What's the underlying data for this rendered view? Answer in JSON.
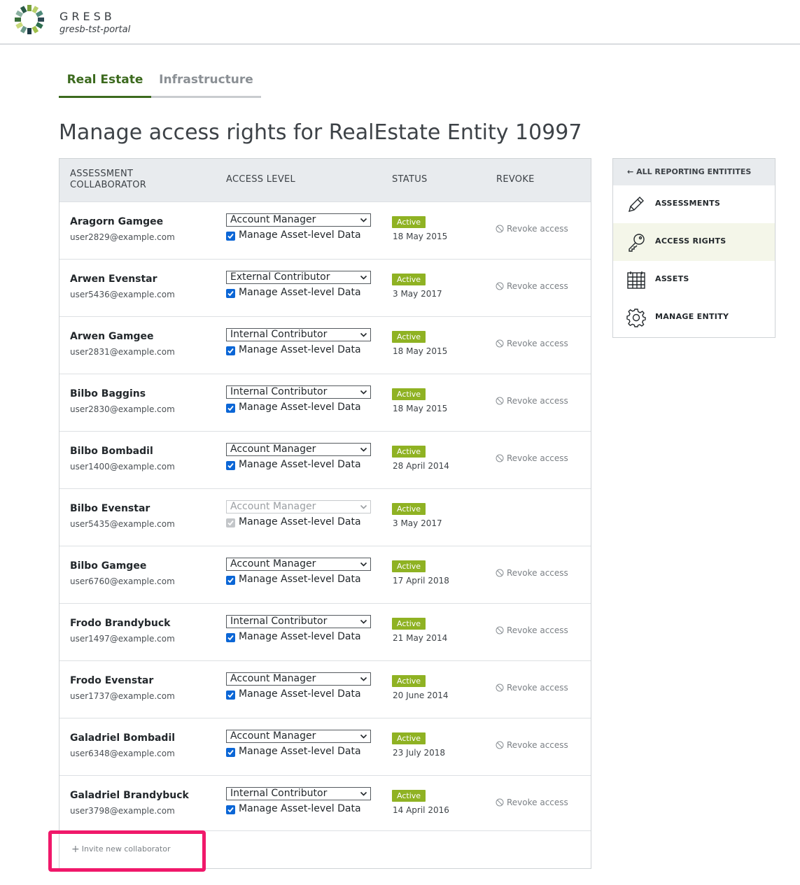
{
  "header": {
    "brand": "GRESB",
    "portal": "gresb-tst-portal"
  },
  "tabs": [
    {
      "label": "Real Estate",
      "active": true
    },
    {
      "label": "Infrastructure",
      "active": false
    }
  ],
  "page": {
    "title": "Manage access rights for RealEstate Entity 10997"
  },
  "table": {
    "headers": {
      "collaborator_line1": "ASSESSMENT",
      "collaborator_line2": "COLLABORATOR",
      "access_level": "ACCESS LEVEL",
      "status": "STATUS",
      "revoke": "REVOKE"
    },
    "checkbox_label": "Manage Asset-level Data",
    "status_label": "Active",
    "revoke_label": "Revoke access",
    "rows": [
      {
        "name": "Aragorn Gamgee",
        "email": "user2829@example.com",
        "access": "Account Manager",
        "date": "18 May 2015",
        "revokable": true
      },
      {
        "name": "Arwen Evenstar",
        "email": "user5436@example.com",
        "access": "External Contributor",
        "date": "3 May 2017",
        "revokable": true
      },
      {
        "name": "Arwen Gamgee",
        "email": "user2831@example.com",
        "access": "Internal Contributor",
        "date": "18 May 2015",
        "revokable": true
      },
      {
        "name": "Bilbo Baggins",
        "email": "user2830@example.com",
        "access": "Internal Contributor",
        "date": "18 May 2015",
        "revokable": true
      },
      {
        "name": "Bilbo Bombadil",
        "email": "user1400@example.com",
        "access": "Account Manager",
        "date": "28 April 2014",
        "revokable": true
      },
      {
        "name": "Bilbo Evenstar",
        "email": "user5435@example.com",
        "access": "Account Manager",
        "date": "3 May 2017",
        "revokable": false
      },
      {
        "name": "Bilbo Gamgee",
        "email": "user6760@example.com",
        "access": "Account Manager",
        "date": "17 April 2018",
        "revokable": true
      },
      {
        "name": "Frodo Brandybuck",
        "email": "user1497@example.com",
        "access": "Internal Contributor",
        "date": "21 May 2014",
        "revokable": true
      },
      {
        "name": "Frodo Evenstar",
        "email": "user1737@example.com",
        "access": "Account Manager",
        "date": "20 June 2014",
        "revokable": true
      },
      {
        "name": "Galadriel Bombadil",
        "email": "user6348@example.com",
        "access": "Account Manager",
        "date": "23 July 2018",
        "revokable": true
      },
      {
        "name": "Galadriel Brandybuck",
        "email": "user3798@example.com",
        "access": "Internal Contributor",
        "date": "14 April 2016",
        "revokable": true
      }
    ],
    "invite_label": "Invite new collaborator"
  },
  "sidenav": {
    "back_label": "ALL REPORTING ENTITITES",
    "items": [
      {
        "label": "ASSESSMENTS",
        "icon": "pencil-icon",
        "active": false
      },
      {
        "label": "ACCESS RIGHTS",
        "icon": "key-icon",
        "active": true
      },
      {
        "label": "ASSETS",
        "icon": "building-icon",
        "active": false
      },
      {
        "label": "MANAGE ENTITY",
        "icon": "gear-icon",
        "active": false
      }
    ]
  },
  "colors": {
    "accent_green": "#3c6a1e",
    "badge_green": "#8fb223",
    "highlight": "#f0186a",
    "checkbox_blue": "#0b66d6"
  }
}
